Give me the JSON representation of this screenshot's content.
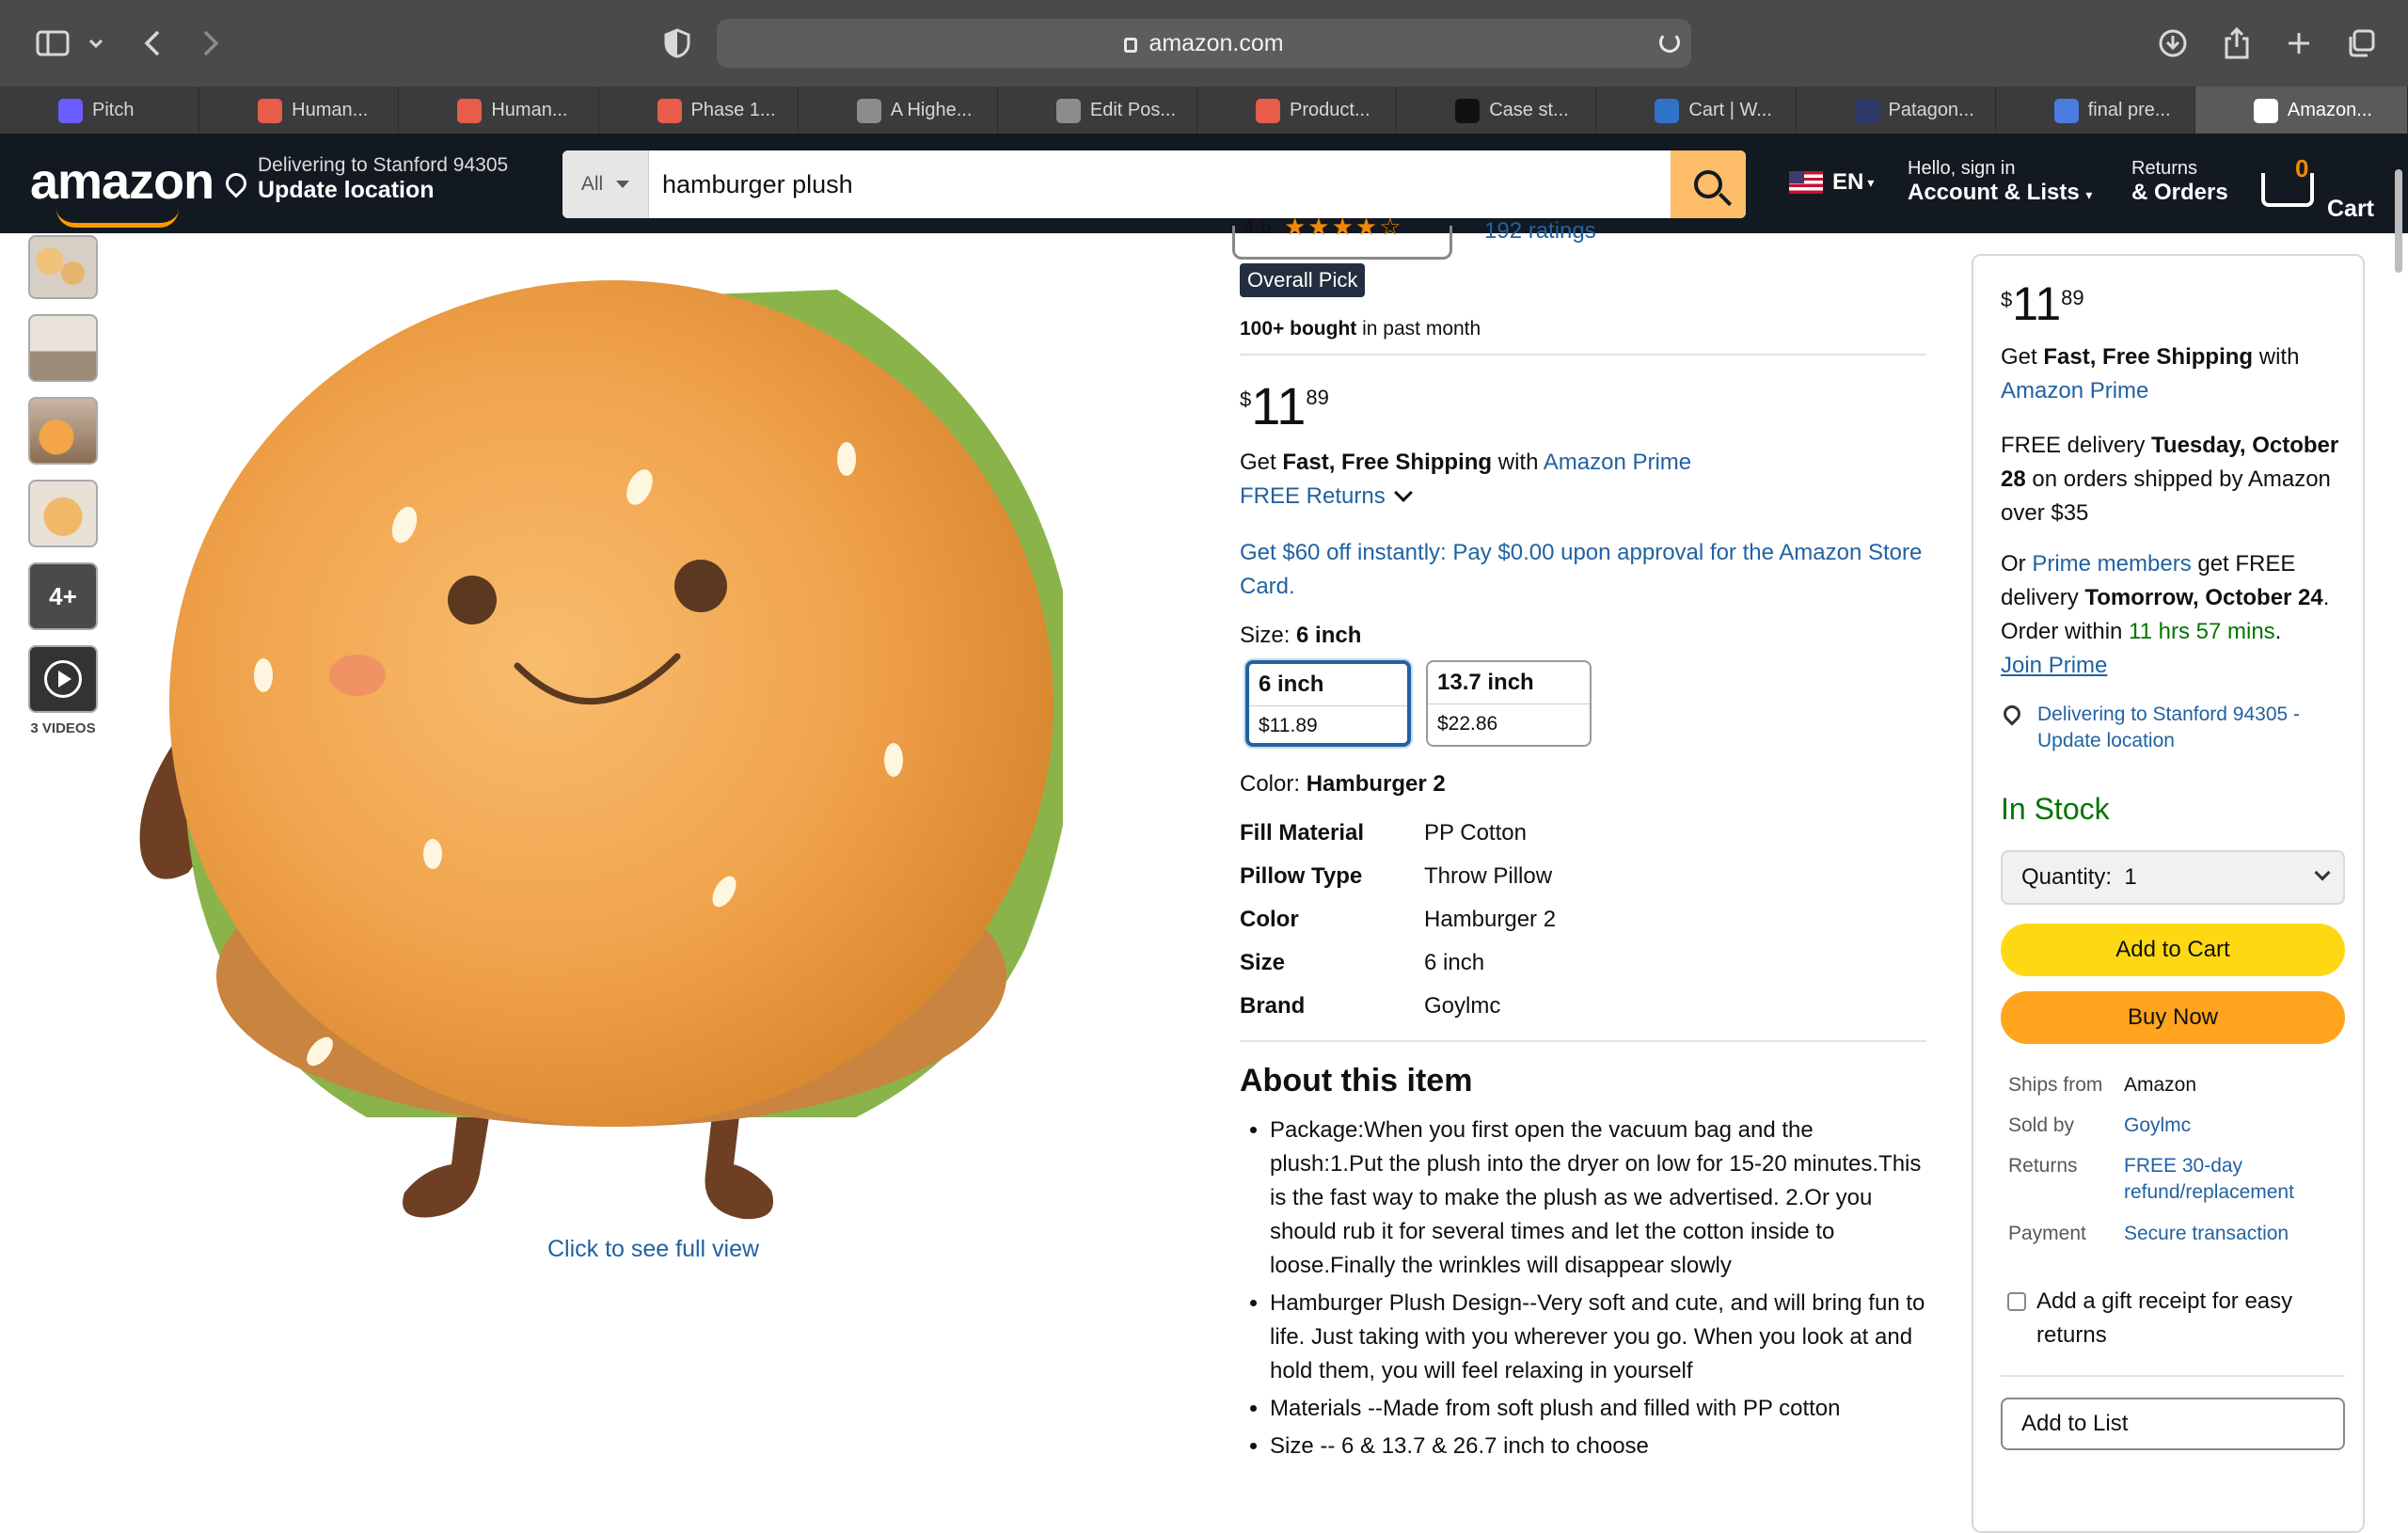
{
  "browser": {
    "url": "amazon.com",
    "tabs": [
      {
        "label": "Pitch",
        "color": "#6b5cff"
      },
      {
        "label": "Human...",
        "color": "#e85c4a"
      },
      {
        "label": "Human...",
        "color": "#e85c4a"
      },
      {
        "label": "Phase 1...",
        "color": "#e85c4a"
      },
      {
        "label": "A Highe...",
        "color": "#8c8c8c"
      },
      {
        "label": "Edit Pos...",
        "color": "#8c8c8c"
      },
      {
        "label": "Product...",
        "color": "#e85c4a"
      },
      {
        "label": "Case st...",
        "color": "#111111"
      },
      {
        "label": "Cart | W...",
        "color": "#2f73c9"
      },
      {
        "label": "Patagon...",
        "color": "#2e3a6a"
      },
      {
        "label": "final pre...",
        "color": "#4a7ce0"
      },
      {
        "label": "Amazon...",
        "color": "#ffffff"
      }
    ]
  },
  "header": {
    "logo": "amazon",
    "deliver_line1": "Delivering to Stanford 94305",
    "deliver_line2": "Update location",
    "search_category": "All",
    "search_value": "hamburger plush",
    "lang": "EN",
    "account_line1": "Hello, sign in",
    "account_line2": "Account & Lists",
    "returns_line1": "Returns",
    "returns_line2": "& Orders",
    "cart_count": "0",
    "cart_label": "Cart"
  },
  "gallery": {
    "more_label": "4+",
    "videos_label": "3 VIDEOS",
    "full_view": "Click to see full view"
  },
  "product": {
    "rating": "4.6",
    "ratings_count": "192 ratings",
    "badge": "Overall Pick",
    "bought_bold": "100+ bought",
    "bought_rest": " in past month",
    "price_symbol": "$",
    "price_whole": "11",
    "price_frac": "89",
    "shipping_pre": "Get ",
    "shipping_bold": "Fast, Free Shipping",
    "shipping_mid": " with ",
    "shipping_link": "Amazon Prime",
    "free_returns": "FREE Returns",
    "promo": "Get $60 off instantly: Pay $0.00 upon approval for the Amazon Store Card.",
    "size_label": "Size: ",
    "size_value": "6 inch",
    "sizes": [
      {
        "name": "6 inch",
        "price": "$11.89"
      },
      {
        "name": "13.7 inch",
        "price": "$22.86"
      }
    ],
    "color_label": "Color: ",
    "color_value": "Hamburger 2",
    "specs": [
      {
        "k": "Fill Material",
        "v": "PP Cotton"
      },
      {
        "k": "Pillow Type",
        "v": "Throw Pillow"
      },
      {
        "k": "Color",
        "v": "Hamburger 2"
      },
      {
        "k": "Size",
        "v": "6 inch"
      },
      {
        "k": "Brand",
        "v": "Goylmc"
      }
    ],
    "about_title": "About this item",
    "bullets": [
      "Package:When you first open the vacuum bag and the plush:1.Put the plush into the dryer on low for 15-20 minutes.This is the fast way to make the plush as we advertised. 2.Or you should rub it for several times and let the cotton inside to loose.Finally the wrinkles will disappear slowly",
      "Hamburger Plush Design--Very soft and cute, and will bring fun to life. Just taking with you wherever you go. When you look at and hold them, you will feel relaxing in yourself",
      "Materials --Made from soft plush and filled with PP cotton",
      "Size -- 6 & 13.7 & 26.7 inch to choose"
    ]
  },
  "buybox": {
    "shipping_pre": "Get ",
    "shipping_bold": "Fast, Free Shipping",
    "shipping_mid": " with",
    "shipping_link": "Amazon Prime",
    "free_delivery_pre": "FREE delivery ",
    "free_delivery_date": "Tuesday, October 28",
    "free_delivery_post": " on orders shipped by Amazon over $35",
    "prime_or": "Or ",
    "prime_link": "Prime members",
    "prime_mid": " get FREE delivery ",
    "prime_date": "Tomorrow, October 24",
    "prime_order": ". Order within ",
    "prime_time": "11 hrs 57 mins",
    "prime_end": ".",
    "join_prime": "Join Prime",
    "deliver_link": "Delivering to Stanford 94305 - Update location",
    "stock": "In Stock",
    "quantity_label": "Quantity:",
    "quantity_value": "1",
    "add_to_cart": "Add to Cart",
    "buy_now": "Buy Now",
    "ships_from_k": "Ships from",
    "ships_from_v": "Amazon",
    "sold_by_k": "Sold by",
    "sold_by_v": "Goylmc",
    "returns_k": "Returns",
    "returns_v": "FREE 30-day refund/replacement",
    "payment_k": "Payment",
    "payment_v": "Secure transaction",
    "gift": "Add a gift receipt for easy returns",
    "add_list": "Add to List"
  },
  "colors": {
    "header_bg": "#131921",
    "link": "#2162a1",
    "cart_btn": "#ffd814",
    "buy_btn": "#ffa41c",
    "stock": "#007600",
    "accent": "#ff9900"
  }
}
